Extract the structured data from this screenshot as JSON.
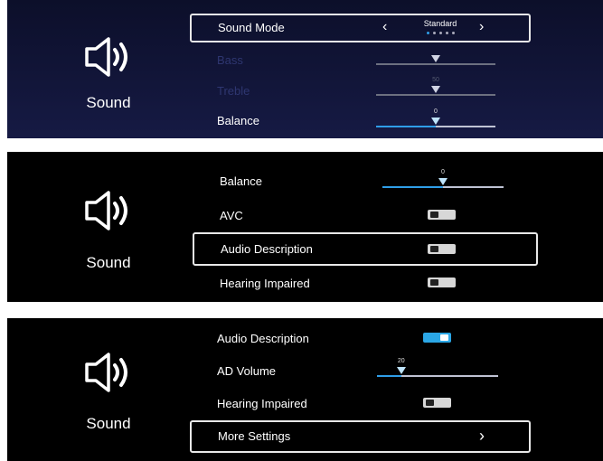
{
  "panel1": {
    "section": {
      "label": "Sound",
      "icon": "speaker-icon"
    },
    "sound_mode": {
      "label": "Sound Mode",
      "value": "Standard",
      "dot_count": 5,
      "active_dot": 1
    },
    "bass": {
      "label": "Bass",
      "level": 50
    },
    "treble": {
      "label": "Treble",
      "value": "50",
      "level": 50
    },
    "balance": {
      "label": "Balance",
      "value": "0",
      "level": 50
    }
  },
  "panel2": {
    "section": {
      "label": "Sound",
      "icon": "speaker-icon"
    },
    "balance": {
      "label": "Balance",
      "value": "0",
      "level": 50
    },
    "avc": {
      "label": "AVC",
      "state": "off"
    },
    "audio_description": {
      "label": "Audio Description",
      "state": "off"
    },
    "hearing_impaired": {
      "label": "Hearing Impaired",
      "state": "off"
    }
  },
  "panel3": {
    "section": {
      "label": "Sound",
      "icon": "speaker-icon"
    },
    "audio_description": {
      "label": "Audio Description",
      "state": "on"
    },
    "ad_volume": {
      "label": "AD Volume",
      "value": "20",
      "level": 20
    },
    "hearing_impaired": {
      "label": "Hearing Impaired",
      "state": "off"
    },
    "more_settings": {
      "label": "More Settings",
      "icon": "chevron-right-icon"
    }
  },
  "colors": {
    "accent": "#2f9ee8",
    "panel_bg_top": "#0c0f2a",
    "panel_bg_bottom": "#161a44",
    "dim_text": "#2e3670"
  }
}
